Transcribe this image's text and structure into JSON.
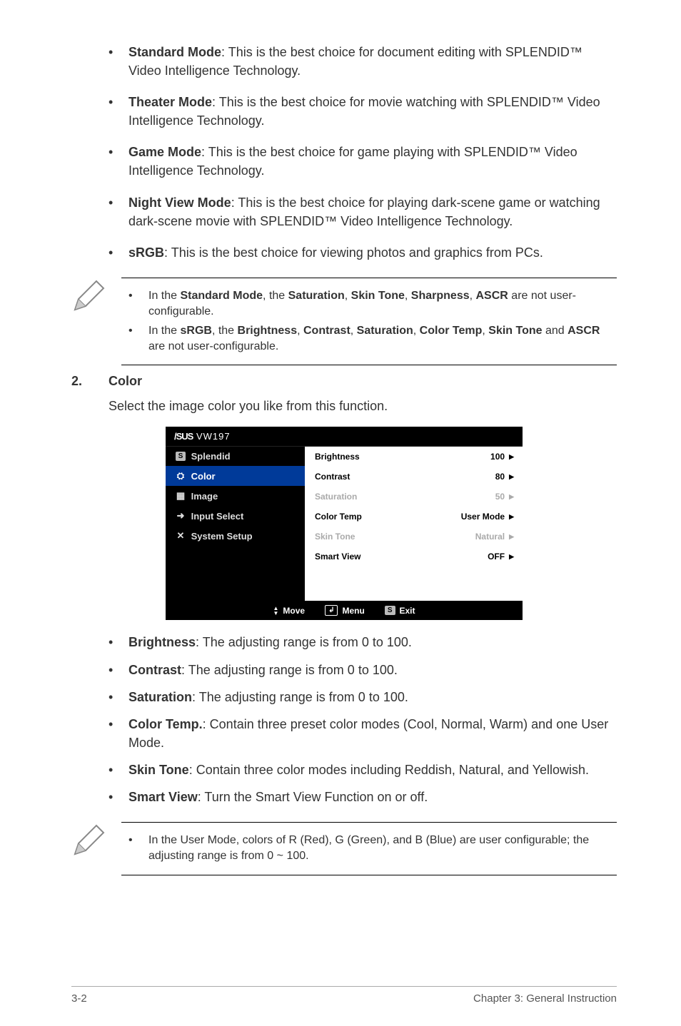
{
  "modes": {
    "standard": {
      "title": "Standard Mode",
      "desc": ": This is the best choice for document editing with SPLENDID™ Video Intelligence Technology."
    },
    "theater": {
      "title": "Theater Mode",
      "desc": ": This is the best choice for movie watching with SPLENDID™ Video Intelligence Technology."
    },
    "game": {
      "title": "Game Mode",
      "desc": ": This is the best choice for game playing with SPLENDID™ Video Intelligence Technology."
    },
    "night": {
      "title": "Night View Mode",
      "desc": ": This is the best choice for playing dark-scene game or watching dark-scene movie with SPLENDID™ Video Intelligence Technology."
    },
    "srgb": {
      "title": "sRGB",
      "desc": ": This is the best choice for viewing photos and graphics from PCs."
    }
  },
  "notes1": {
    "a_pre": "In the ",
    "a_b1": "Standard Mode",
    "a_mid": ", the ",
    "a_b2": "Saturation",
    "a_c": ", ",
    "a_b3": "Skin Tone",
    "a_b4": "Sharpness",
    "a_b5": "ASCR",
    "a_end": " are not user-configurable.",
    "b_pre": "In the ",
    "b_b1": "sRGB",
    "b_mid": ", the ",
    "b_b2": "Brightness",
    "b_b3": "Contrast",
    "b_b4": "Saturation",
    "b_b5": "Color Temp",
    "b_b6": "Skin Tone",
    "b_and": " and ",
    "b_b7": "ASCR",
    "b_end": " are not user-configurable."
  },
  "section2": {
    "num": "2.",
    "title": "Color",
    "intro": "Select the image color you like from this function."
  },
  "osd": {
    "brand": "/SUS",
    "model": "VW197",
    "left": [
      {
        "icon": "S",
        "label": "Splendid"
      },
      {
        "icon": "⚙",
        "label": "Color",
        "sel": true
      },
      {
        "icon": "▦",
        "label": "Image"
      },
      {
        "icon": "⊕",
        "label": "Input Select"
      },
      {
        "icon": "✕",
        "label": "System Setup"
      }
    ],
    "right": [
      {
        "label": "Brightness",
        "value": "100",
        "dis": false
      },
      {
        "label": "Contrast",
        "value": "80",
        "dis": false
      },
      {
        "label": "Saturation",
        "value": "50",
        "dis": true
      },
      {
        "label": "Color Temp",
        "value": "User Mode",
        "dis": false
      },
      {
        "label": "Skin Tone",
        "value": "Natural",
        "dis": true
      },
      {
        "label": "Smart View",
        "value": "OFF",
        "dis": false
      }
    ],
    "footer": {
      "move": "Move",
      "menu": "Menu",
      "exit": "Exit"
    }
  },
  "lower": {
    "brightness": {
      "t": "Brightness",
      "d": ": The adjusting range is from 0 to 100."
    },
    "contrast": {
      "t": "Contrast",
      "d": ": The adjusting range is from 0 to 100."
    },
    "saturation": {
      "t": "Saturation",
      "d": ": The adjusting range is from 0 to 100."
    },
    "colortemp": {
      "t": "Color Temp.",
      "d": ": Contain three preset color modes (Cool, Normal, Warm) and one User Mode."
    },
    "skintone": {
      "t": "Skin Tone",
      "d": ": Contain three color modes including Reddish, Natural, and Yellowish."
    },
    "smartview": {
      "t": "Smart View",
      "d": ": Turn the Smart View Function on or off."
    }
  },
  "note2": "In the User Mode, colors of R (Red), G (Green), and B (Blue) are user configurable; the adjusting range is from 0 ~ 100.",
  "footer": {
    "page": "3-2",
    "chapter": "Chapter 3: General Instruction"
  }
}
